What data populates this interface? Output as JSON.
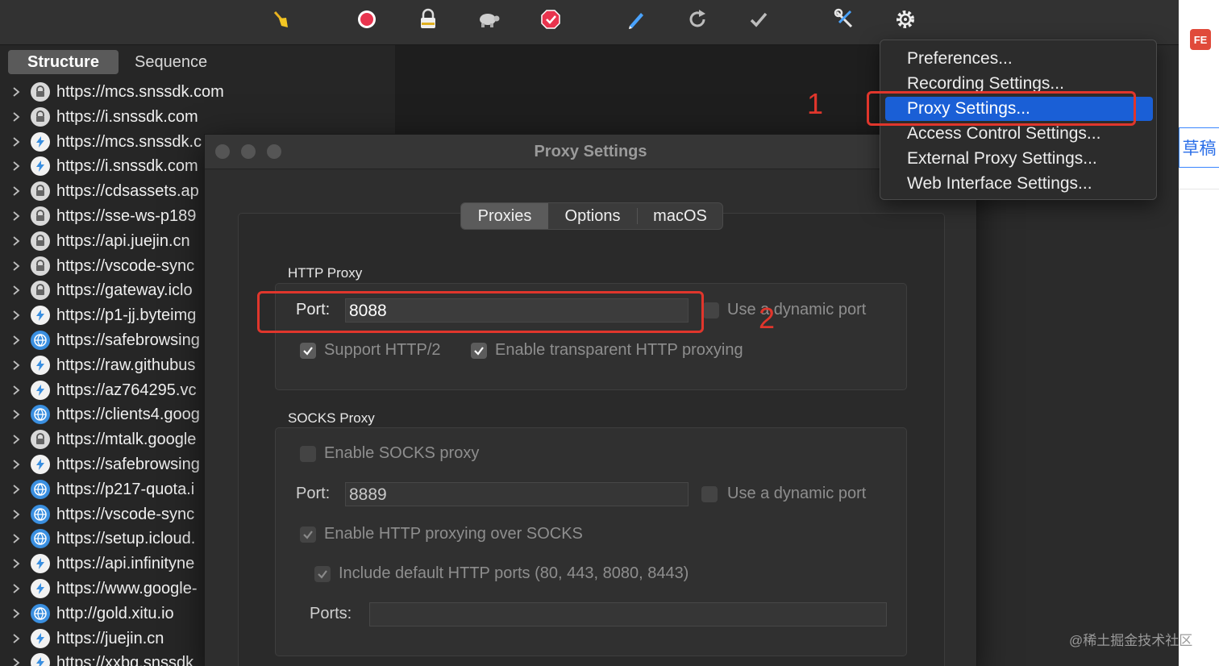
{
  "toolbar": {
    "icons": [
      "broom-icon",
      "record-icon",
      "ssl-lock-icon",
      "throttle-turtle-icon",
      "breakpoint-icon",
      "compose-pen-icon",
      "repeat-icon",
      "validate-check-icon",
      "tools-icon",
      "settings-gear-icon"
    ]
  },
  "sidebar": {
    "tabs": [
      {
        "label": "Structure",
        "active": true
      },
      {
        "label": "Sequence",
        "active": false
      }
    ],
    "rows": [
      {
        "icon": "lock",
        "label": "https://mcs.snssdk.com"
      },
      {
        "icon": "lock",
        "label": "https://i.snssdk.com"
      },
      {
        "icon": "bolt",
        "label": "https://mcs.snssdk.c"
      },
      {
        "icon": "bolt",
        "label": "https://i.snssdk.com"
      },
      {
        "icon": "lock",
        "label": "https://cdsassets.ap"
      },
      {
        "icon": "lock",
        "label": "https://sse-ws-p189"
      },
      {
        "icon": "lock",
        "label": "https://api.juejin.cn"
      },
      {
        "icon": "lock",
        "label": "https://vscode-sync"
      },
      {
        "icon": "lock",
        "label": "https://gateway.iclo"
      },
      {
        "icon": "bolt",
        "label": "https://p1-jj.byteimg"
      },
      {
        "icon": "globe",
        "label": "https://safebrowsing"
      },
      {
        "icon": "bolt",
        "label": "https://raw.githubus"
      },
      {
        "icon": "bolt",
        "label": "https://az764295.vc"
      },
      {
        "icon": "globe",
        "label": "https://clients4.goog"
      },
      {
        "icon": "lock",
        "label": "https://mtalk.google"
      },
      {
        "icon": "bolt",
        "label": "https://safebrowsing"
      },
      {
        "icon": "globe",
        "label": "https://p217-quota.i"
      },
      {
        "icon": "globe",
        "label": "https://vscode-sync"
      },
      {
        "icon": "globe",
        "label": "https://setup.icloud."
      },
      {
        "icon": "bolt",
        "label": "https://api.infinityne"
      },
      {
        "icon": "bolt",
        "label": "https://www.google-"
      },
      {
        "icon": "globe",
        "label": "http://gold.xitu.io"
      },
      {
        "icon": "bolt",
        "label": "https://juejin.cn"
      },
      {
        "icon": "bolt",
        "label": "https://xxbg.snssdk"
      }
    ]
  },
  "dialog": {
    "title": "Proxy Settings",
    "tabs": [
      {
        "label": "Proxies",
        "active": true
      },
      {
        "label": "Options",
        "active": false
      },
      {
        "label": "macOS",
        "active": false
      }
    ],
    "http": {
      "section_label": "HTTP Proxy",
      "port_label": "Port:",
      "port_value": "8088",
      "dynamic_port_label": "Use a dynamic port",
      "dynamic_port_checked": false,
      "http2_label": "Support HTTP/2",
      "http2_checked": true,
      "transparent_label": "Enable transparent HTTP proxying",
      "transparent_checked": true
    },
    "socks": {
      "section_label": "SOCKS Proxy",
      "enable_label": "Enable SOCKS proxy",
      "enable_checked": false,
      "port_label": "Port:",
      "port_value": "8889",
      "dynamic_port_label": "Use a dynamic port",
      "dynamic_port_checked": false,
      "http_over_socks_label": "Enable HTTP proxying over SOCKS",
      "http_over_socks_checked": true,
      "default_ports_label": "Include default HTTP ports (80, 443, 8080, 8443)",
      "default_ports_checked": true,
      "ports_label": "Ports:",
      "ports_value": ""
    }
  },
  "menu": {
    "items": [
      {
        "label": "Preferences...",
        "highlighted": false
      },
      {
        "label": "Recording Settings...",
        "highlighted": false
      },
      {
        "label": "Proxy Settings...",
        "highlighted": true
      },
      {
        "label": "Access Control Settings...",
        "highlighted": false
      },
      {
        "label": "External Proxy Settings...",
        "highlighted": false
      },
      {
        "label": "Web Interface Settings...",
        "highlighted": false
      }
    ]
  },
  "annotations": {
    "step1": "1",
    "step2": "2",
    "color": "#e0362c"
  },
  "browser": {
    "extension_badge": "FE",
    "tab_text": "草稿",
    "watermark": "@稀土掘金技术社区"
  },
  "colors": {
    "highlight": "#1a5fd6",
    "globe": "#3a8fe0",
    "record": "#e8344e"
  }
}
